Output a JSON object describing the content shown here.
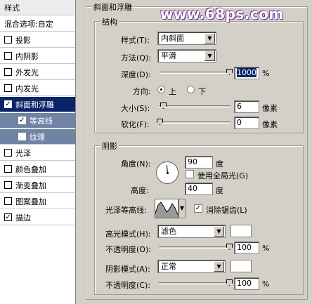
{
  "watermark": "www.68ps.com",
  "sidebar": {
    "items": [
      {
        "label": "样式",
        "checked": null
      },
      {
        "label": "混合选项:自定",
        "checked": null
      },
      {
        "label": "投影",
        "checked": false
      },
      {
        "label": "内阴影",
        "checked": false
      },
      {
        "label": "外发光",
        "checked": false
      },
      {
        "label": "内发光",
        "checked": false
      },
      {
        "label": "斜面和浮雕",
        "checked": true
      },
      {
        "label": "等高线",
        "checked": true
      },
      {
        "label": "纹理",
        "checked": false
      },
      {
        "label": "光泽",
        "checked": false
      },
      {
        "label": "颜色叠加",
        "checked": false
      },
      {
        "label": "渐变叠加",
        "checked": false
      },
      {
        "label": "图案叠加",
        "checked": false
      },
      {
        "label": "描边",
        "checked": true
      }
    ]
  },
  "bevel": {
    "title": "斜面和浮雕",
    "structure_title": "结构",
    "style_label": "样式(T):",
    "style_value": "内斜面",
    "technique_label": "方法(Q):",
    "technique_value": "平滑",
    "depth_label": "深度(D):",
    "depth_value": "1000",
    "depth_unit": "%",
    "depth_level": 1.0,
    "direction_label": "方向:",
    "direction_up": "上",
    "direction_down": "下",
    "direction_selected": "上",
    "size_label": "大小(S):",
    "size_value": "6",
    "size_unit": "像素",
    "soften_label": "软化(F):",
    "soften_value": "0",
    "soften_unit": "像素"
  },
  "shading": {
    "title": "阴影",
    "angle_label": "角度(N):",
    "angle_value": "90",
    "angle_unit": "度",
    "global_light_label": "使用全局光(G)",
    "global_light_checked": false,
    "altitude_label": "高度:",
    "altitude_value": "40",
    "altitude_unit": "度",
    "gloss_contour_label": "光泽等高线:",
    "anti_aliased_label": "消除锯齿(L)",
    "anti_aliased_checked": true,
    "highlight_mode_label": "高光模式(H):",
    "highlight_mode_value": "滤色",
    "highlight_color": "#ffffff",
    "highlight_opacity_label": "不透明度(O):",
    "highlight_opacity_value": "100",
    "highlight_opacity_unit": "%",
    "shadow_mode_label": "阴影模式(A):",
    "shadow_mode_value": "正常",
    "shadow_color": "#ffffff",
    "shadow_opacity_label": "不透明度(C):",
    "shadow_opacity_value": "100",
    "shadow_opacity_unit": "%"
  },
  "colors": {
    "selected_row": "#0a246a",
    "sub_row": "#6f83a5",
    "dialog_bg": "#d4d0c8"
  }
}
